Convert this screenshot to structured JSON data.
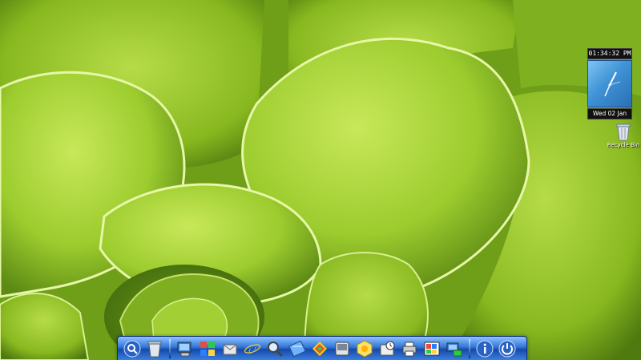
{
  "clock": {
    "time": "01:34:32 PM",
    "date": "Wed 02 Jan"
  },
  "desktop_icons": [
    {
      "label": "Recycle Bin",
      "icon": "recycle-bin-icon"
    }
  ],
  "dock": {
    "items": [
      {
        "icon": "search-icon"
      },
      {
        "icon": "trash-icon"
      },
      {
        "icon": "computer-icon"
      },
      {
        "icon": "windows-flag-icon"
      },
      {
        "icon": "documents-icon"
      },
      {
        "icon": "internet-explorer-icon"
      },
      {
        "icon": "magnifier-icon"
      },
      {
        "icon": "notes-icon"
      },
      {
        "icon": "colors-icon"
      },
      {
        "icon": "drive-icon"
      },
      {
        "icon": "sun-icon"
      },
      {
        "icon": "clock-icon"
      },
      {
        "icon": "printer-icon"
      },
      {
        "icon": "paint-icon"
      },
      {
        "icon": "network-icon"
      },
      {
        "icon": "info-icon"
      },
      {
        "icon": "power-icon"
      }
    ]
  },
  "colors": {
    "dock_blue": "#2f74d8",
    "leaf_green": "#9ccc2e"
  }
}
